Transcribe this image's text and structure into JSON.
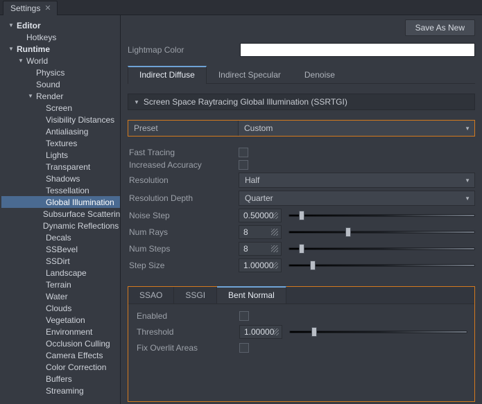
{
  "window": {
    "tab_title": "Settings"
  },
  "toolbar": {
    "save_as_new": "Save As New"
  },
  "sidebar": {
    "items": [
      {
        "label": "Editor",
        "indent": 0,
        "arrow": "down",
        "bold": true,
        "selected": false
      },
      {
        "label": "Hotkeys",
        "indent": 1,
        "arrow": "",
        "bold": false,
        "selected": false
      },
      {
        "label": "Runtime",
        "indent": 0,
        "arrow": "down",
        "bold": true,
        "selected": false
      },
      {
        "label": "World",
        "indent": 1,
        "arrow": "down",
        "bold": false,
        "selected": false
      },
      {
        "label": "Physics",
        "indent": 2,
        "arrow": "",
        "bold": false,
        "selected": false
      },
      {
        "label": "Sound",
        "indent": 2,
        "arrow": "",
        "bold": false,
        "selected": false
      },
      {
        "label": "Render",
        "indent": 2,
        "arrow": "down",
        "bold": false,
        "selected": false
      },
      {
        "label": "Screen",
        "indent": 3,
        "arrow": "",
        "bold": false,
        "selected": false
      },
      {
        "label": "Visibility Distances",
        "indent": 3,
        "arrow": "",
        "bold": false,
        "selected": false
      },
      {
        "label": "Antialiasing",
        "indent": 3,
        "arrow": "",
        "bold": false,
        "selected": false
      },
      {
        "label": "Textures",
        "indent": 3,
        "arrow": "",
        "bold": false,
        "selected": false
      },
      {
        "label": "Lights",
        "indent": 3,
        "arrow": "",
        "bold": false,
        "selected": false
      },
      {
        "label": "Transparent",
        "indent": 3,
        "arrow": "",
        "bold": false,
        "selected": false
      },
      {
        "label": "Shadows",
        "indent": 3,
        "arrow": "",
        "bold": false,
        "selected": false
      },
      {
        "label": "Tessellation",
        "indent": 3,
        "arrow": "",
        "bold": false,
        "selected": false
      },
      {
        "label": "Global Illumination",
        "indent": 3,
        "arrow": "",
        "bold": false,
        "selected": true
      },
      {
        "label": "Subsurface Scattering",
        "indent": 3,
        "arrow": "",
        "bold": false,
        "selected": false
      },
      {
        "label": "Dynamic Reflections",
        "indent": 3,
        "arrow": "",
        "bold": false,
        "selected": false
      },
      {
        "label": "Decals",
        "indent": 3,
        "arrow": "",
        "bold": false,
        "selected": false
      },
      {
        "label": "SSBevel",
        "indent": 3,
        "arrow": "",
        "bold": false,
        "selected": false
      },
      {
        "label": "SSDirt",
        "indent": 3,
        "arrow": "",
        "bold": false,
        "selected": false
      },
      {
        "label": "Landscape",
        "indent": 3,
        "arrow": "",
        "bold": false,
        "selected": false
      },
      {
        "label": "Terrain",
        "indent": 3,
        "arrow": "",
        "bold": false,
        "selected": false
      },
      {
        "label": "Water",
        "indent": 3,
        "arrow": "",
        "bold": false,
        "selected": false
      },
      {
        "label": "Clouds",
        "indent": 3,
        "arrow": "",
        "bold": false,
        "selected": false
      },
      {
        "label": "Vegetation",
        "indent": 3,
        "arrow": "",
        "bold": false,
        "selected": false
      },
      {
        "label": "Environment",
        "indent": 3,
        "arrow": "",
        "bold": false,
        "selected": false
      },
      {
        "label": "Occlusion Culling",
        "indent": 3,
        "arrow": "",
        "bold": false,
        "selected": false
      },
      {
        "label": "Camera Effects",
        "indent": 3,
        "arrow": "",
        "bold": false,
        "selected": false
      },
      {
        "label": "Color Correction",
        "indent": 3,
        "arrow": "",
        "bold": false,
        "selected": false
      },
      {
        "label": "Buffers",
        "indent": 3,
        "arrow": "",
        "bold": false,
        "selected": false
      },
      {
        "label": "Streaming",
        "indent": 3,
        "arrow": "",
        "bold": false,
        "selected": false
      }
    ]
  },
  "fields": {
    "lightmap_color": {
      "label": "Lightmap Color",
      "value_hex": "#ffffff"
    }
  },
  "tabs": {
    "indirect_diffuse": "Indirect Diffuse",
    "indirect_specular": "Indirect Specular",
    "denoise": "Denoise",
    "active": "indirect_diffuse"
  },
  "section": {
    "title": "Screen Space Raytracing Global Illumination (SSRTGI)"
  },
  "preset": {
    "label": "Preset",
    "value": "Custom"
  },
  "settings": {
    "fast_tracing": {
      "label": "Fast Tracing",
      "checked": false
    },
    "increased_accuracy": {
      "label": "Increased Accuracy",
      "checked": false
    },
    "resolution": {
      "label": "Resolution",
      "value": "Half"
    },
    "resolution_depth": {
      "label": "Resolution Depth",
      "value": "Quarter"
    },
    "noise_step": {
      "label": "Noise Step",
      "value": "0.50000",
      "slider_pct": 7
    },
    "num_rays": {
      "label": "Num Rays",
      "value": "8",
      "slider_pct": 32
    },
    "num_steps": {
      "label": "Num Steps",
      "value": "8",
      "slider_pct": 7
    },
    "step_size": {
      "label": "Step Size",
      "value": "1.00000",
      "slider_pct": 13
    }
  },
  "subtabs": {
    "ssao": "SSAO",
    "ssgi": "SSGI",
    "bent_normal": "Bent Normal",
    "active": "bent_normal"
  },
  "bent_normal": {
    "enabled": {
      "label": "Enabled",
      "checked": false
    },
    "threshold": {
      "label": "Threshold",
      "value": "1.00000",
      "slider_pct": 14
    },
    "fix_overlit": {
      "label": "Fix Overlit Areas",
      "checked": false
    }
  }
}
